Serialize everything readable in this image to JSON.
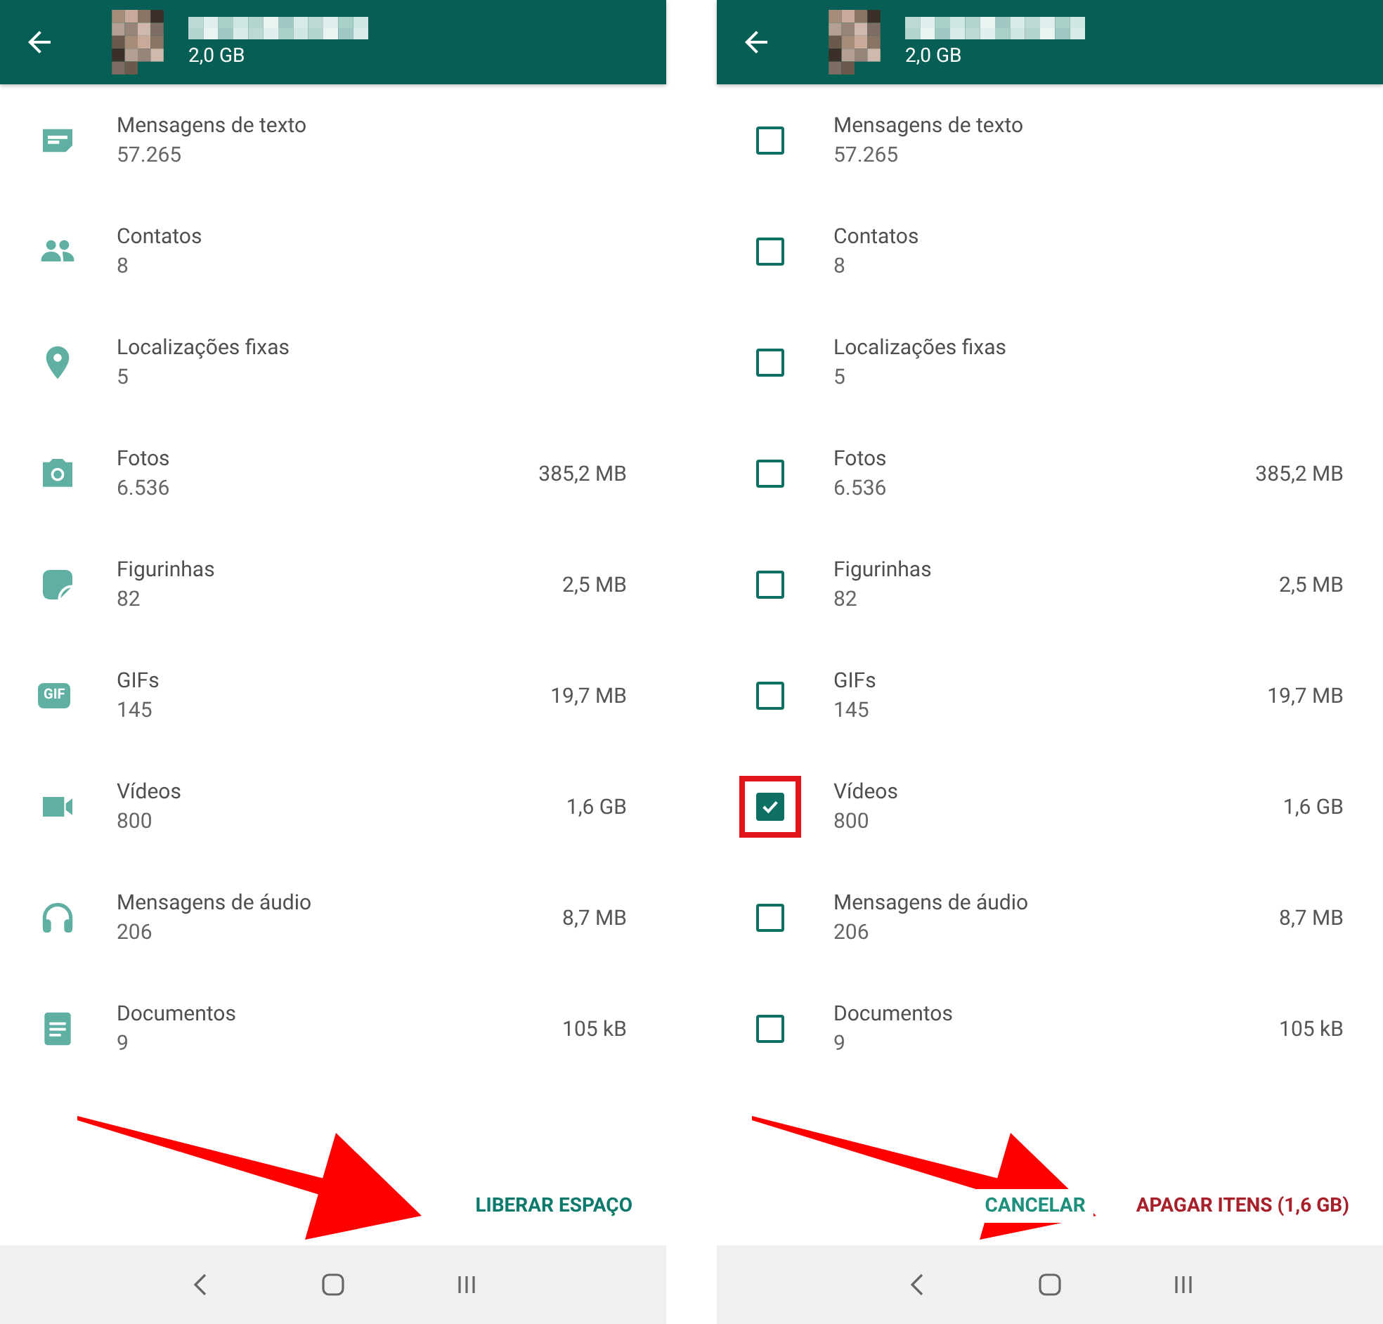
{
  "panels": [
    {
      "header": {
        "size": "2,0 GB"
      },
      "items": [
        {
          "kind": "message",
          "label": "Mensagens de texto",
          "count": "57.265"
        },
        {
          "kind": "contacts",
          "label": "Contatos",
          "count": "8"
        },
        {
          "kind": "location",
          "label": "Localizações fixas",
          "count": "5"
        },
        {
          "kind": "camera",
          "label": "Fotos",
          "count": "6.536",
          "size": "385,2 MB"
        },
        {
          "kind": "sticker",
          "label": "Figurinhas",
          "count": "82",
          "size": "2,5 MB"
        },
        {
          "kind": "gif",
          "badge": "GIF",
          "label": "GIFs",
          "count": "145",
          "size": "19,7 MB"
        },
        {
          "kind": "video",
          "label": "Vídeos",
          "count": "800",
          "size": "1,6 GB"
        },
        {
          "kind": "headphones",
          "label": "Mensagens de áudio",
          "count": "206",
          "size": "8,7 MB"
        },
        {
          "kind": "document",
          "label": "Documentos",
          "count": "9",
          "size": "105 kB"
        }
      ],
      "actions": [
        {
          "kind": "primary",
          "label": "LIBERAR ESPAÇO"
        }
      ]
    },
    {
      "header": {
        "size": "2,0 GB"
      },
      "items": [
        {
          "label": "Mensagens de texto",
          "count": "57.265",
          "checked": false,
          "highlighted": false
        },
        {
          "label": "Contatos",
          "count": "8",
          "checked": false,
          "highlighted": false
        },
        {
          "label": "Localizações fixas",
          "count": "5",
          "checked": false,
          "highlighted": false
        },
        {
          "label": "Fotos",
          "count": "6.536",
          "size": "385,2 MB",
          "checked": false,
          "highlighted": false
        },
        {
          "label": "Figurinhas",
          "count": "82",
          "size": "2,5 MB",
          "checked": false,
          "highlighted": false
        },
        {
          "label": "GIFs",
          "count": "145",
          "size": "19,7 MB",
          "checked": false,
          "highlighted": false
        },
        {
          "label": "Vídeos",
          "count": "800",
          "size": "1,6 GB",
          "checked": true,
          "highlighted": true
        },
        {
          "label": "Mensagens de áudio",
          "count": "206",
          "size": "8,7 MB",
          "checked": false,
          "highlighted": false
        },
        {
          "label": "Documentos",
          "count": "9",
          "size": "105 kB",
          "checked": false,
          "highlighted": false
        }
      ],
      "actions": [
        {
          "kind": "cancel",
          "label": "CANCELAR"
        },
        {
          "kind": "danger",
          "label": "APAGAR ITENS (1,6 GB)"
        }
      ]
    }
  ]
}
